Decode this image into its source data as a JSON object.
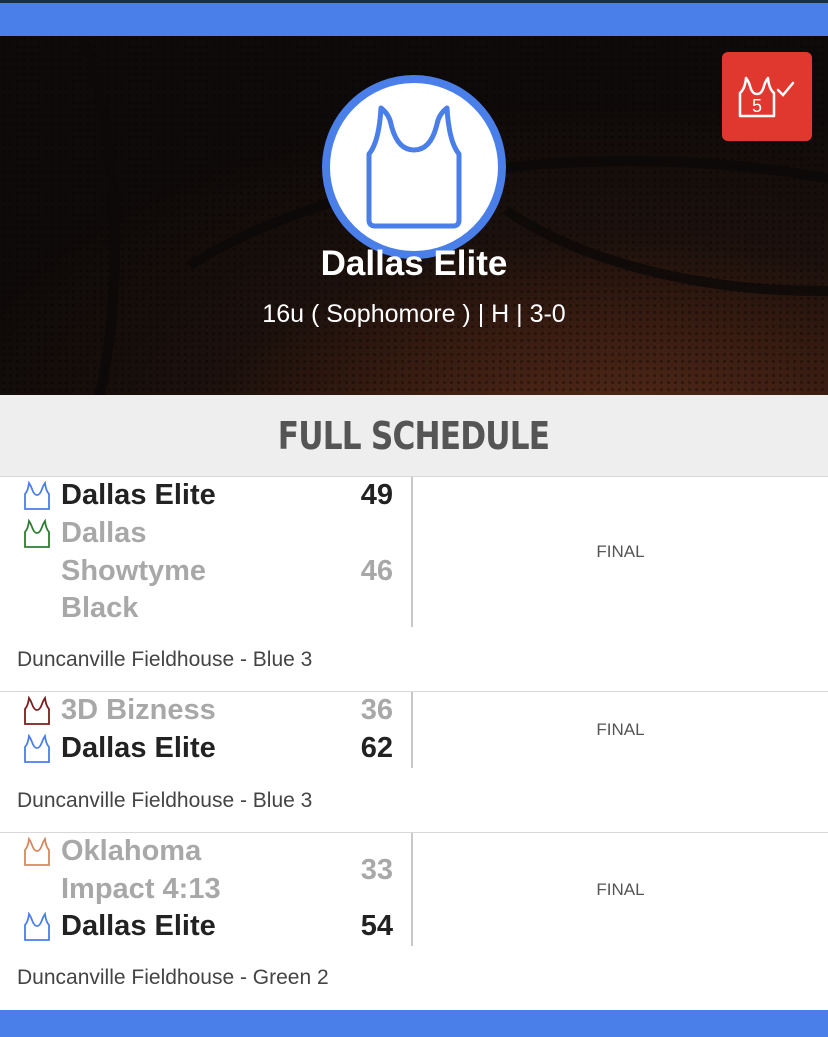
{
  "team": {
    "name": "Dallas Elite",
    "subtitle": "16u ( Sophomore ) | H | 3-0",
    "badge_number": "5"
  },
  "schedule": {
    "heading": "FULL SCHEDULE",
    "games": [
      {
        "teams": [
          {
            "name": "Dallas Elite",
            "score": "49",
            "jersey_color": "#4a7fe9",
            "winner": true
          },
          {
            "name": "Dallas Showtyme Black",
            "score": "46",
            "jersey_color": "#2e7d32",
            "winner": false
          }
        ],
        "status": "FINAL",
        "venue": "Duncanville Fieldhouse - Blue 3"
      },
      {
        "teams": [
          {
            "name": "3D Bizness",
            "score": "36",
            "jersey_color": "#7b1e1e",
            "winner": false
          },
          {
            "name": "Dallas Elite",
            "score": "62",
            "jersey_color": "#4a7fe9",
            "winner": true
          }
        ],
        "status": "FINAL",
        "venue": "Duncanville Fieldhouse - Blue 3"
      },
      {
        "teams": [
          {
            "name": "Oklahoma Impact 4:13",
            "score": "33",
            "jersey_color": "#d9875e",
            "winner": false
          },
          {
            "name": "Dallas Elite",
            "score": "54",
            "jersey_color": "#4a7fe9",
            "winner": true
          }
        ],
        "status": "FINAL",
        "venue": "Duncanville Fieldhouse - Green 2"
      }
    ]
  },
  "colors": {
    "accent": "#4a7fe9",
    "badge": "#e0382f"
  }
}
